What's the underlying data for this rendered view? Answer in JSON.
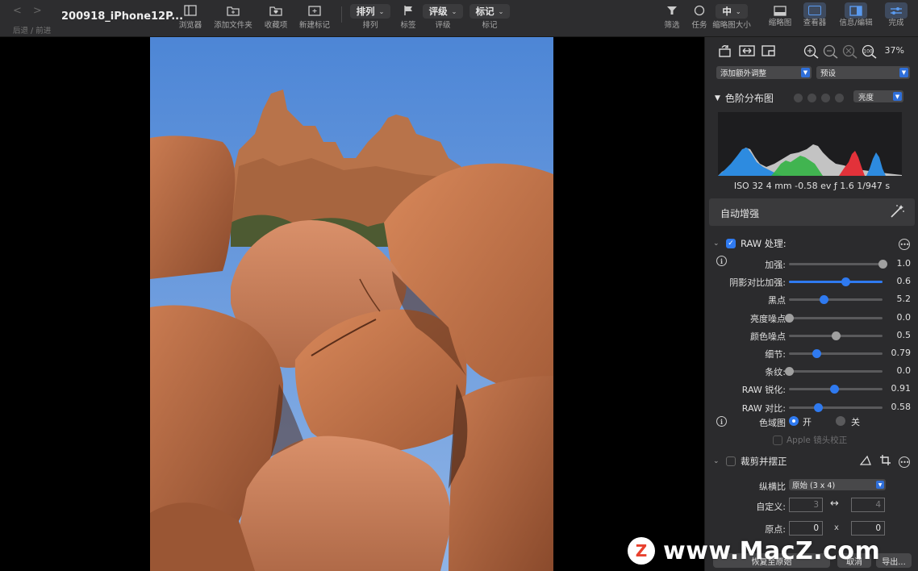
{
  "toolbar": {
    "nav_back": "<",
    "nav_forward": ">",
    "nav_label": "后退 / 前进",
    "title": "200918_iPhone12P...",
    "browser": "浏览器",
    "add_folder": "添加文件夹",
    "favorites": "收藏项",
    "new_tag": "新建标记",
    "sort_value": "排列",
    "sort_label": "排列",
    "flag_label": "标签",
    "rating_value": "评级",
    "rating_label": "评级",
    "tag_value": "标记",
    "tag_label": "标记",
    "filter": "筛选",
    "tasks": "任务",
    "thumb_size_value": "中",
    "thumb_size_label": "缩略图大小",
    "thumbnails": "缩略图",
    "viewer": "查看器",
    "info_edit": "信息/编辑",
    "done": "完成"
  },
  "panel": {
    "zoom": "37%",
    "add_adjust": "添加额外调整",
    "preset": "预设",
    "histogram_title": "色阶分布图",
    "histogram_mode": "亮度",
    "exif": "ISO 32  4 mm  -0.58 ev  ƒ 1.6  1/947 s",
    "auto_enhance": "自动增强",
    "raw_title": "RAW 处理:",
    "sliders": [
      {
        "label": "加强:",
        "value": "1.0",
        "pos": 1.0,
        "fill": 0,
        "knob": "gray"
      },
      {
        "label": "阴影对比加强:",
        "value": "0.6",
        "pos": 0.6,
        "fill": 1,
        "knob": "blue"
      },
      {
        "label": "黑点",
        "value": "5.2",
        "pos": 0.37,
        "fill": 0,
        "knob": "blue"
      },
      {
        "label": "亮度噪点",
        "value": "0.0",
        "pos": 0.0,
        "fill": 0,
        "knob": "gray"
      },
      {
        "label": "颜色噪点",
        "value": "0.5",
        "pos": 0.5,
        "fill": 0,
        "knob": "gray"
      },
      {
        "label": "细节:",
        "value": "0.79",
        "pos": 0.29,
        "fill": 0,
        "knob": "blue"
      },
      {
        "label": "条纹:",
        "value": "0.0",
        "pos": 0.0,
        "fill": 0,
        "knob": "gray"
      },
      {
        "label": "RAW 锐化:",
        "value": "0.91",
        "pos": 0.48,
        "fill": 0,
        "knob": "blue"
      },
      {
        "label": "RAW 对比:",
        "value": "0.58",
        "pos": 0.31,
        "fill": 0,
        "knob": "blue"
      }
    ],
    "gamut_label": "色域图",
    "gamut_on": "开",
    "gamut_off": "关",
    "lens_correction": "Apple 镜头校正",
    "crop_title": "裁剪并摆正",
    "aspect_label": "纵横比",
    "aspect_value": "原始 (3 x 4)",
    "custom_label": "自定义:",
    "custom_w": "3",
    "custom_h": "4",
    "origin_label": "原点:",
    "origin_x": "0",
    "origin_y": "0",
    "origin_sep": "x",
    "reset_btn": "恢复至原始",
    "cancel_btn": "取消",
    "export_btn": "导出..."
  },
  "watermark": {
    "logo": "Z",
    "text": "www.MacZ.com"
  },
  "colors": {
    "accent": "#2f7af0",
    "toolbar_bg": "#2d2d2f",
    "panel_bg": "#2b2b2d",
    "sky": "#5b8fd9",
    "rock": "#c87a4f"
  }
}
